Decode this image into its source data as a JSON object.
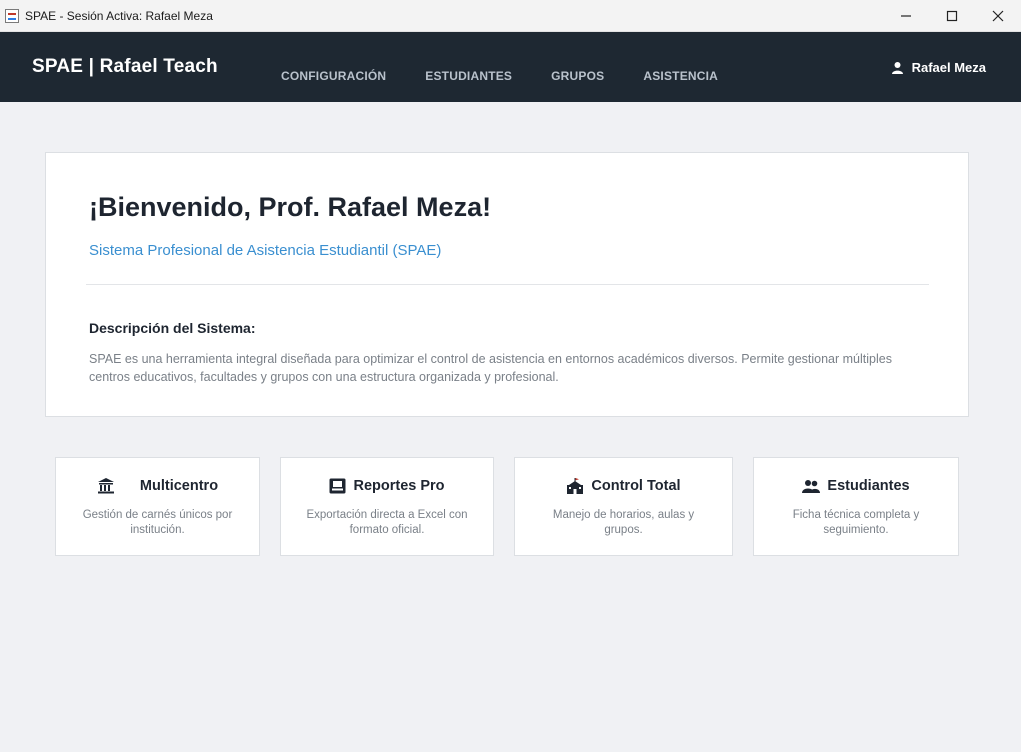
{
  "window": {
    "title": "SPAE - Sesión Activa: Rafael Meza",
    "minimize_icon": "minimize-icon",
    "maximize_icon": "maximize-icon",
    "close_icon": "close-icon"
  },
  "navbar": {
    "brand": "SPAE | Rafael Teach",
    "links": [
      "CONFIGURACIÓN",
      "ESTUDIANTES",
      "GRUPOS",
      "ASISTENCIA"
    ],
    "user": {
      "icon": "user-icon",
      "name": "Rafael Meza"
    }
  },
  "welcome": {
    "title": "¡Bienvenido, Prof. Rafael Meza!",
    "subtitle": "Sistema Profesional de Asistencia Estudiantil (SPAE)",
    "description_title": "Descripción del Sistema:",
    "description": "SPAE es una herramienta integral diseñada para optimizar el control de asistencia en entornos académicos diversos. Permite gestionar múltiples centros educativos, facultades y grupos con una estructura organizada y profesional."
  },
  "features": [
    {
      "icon": "bank-icon",
      "title": "Multicentro",
      "text": "Gestión de carnés únicos por institución."
    },
    {
      "icon": "report-icon",
      "title": "Reportes Pro",
      "text": "Exportación directa a Excel con formato oficial."
    },
    {
      "icon": "school-icon",
      "title": "Control Total",
      "text": "Manejo de horarios, aulas y grupos."
    },
    {
      "icon": "students-icon",
      "title": "Estudiantes",
      "text": "Ficha técnica completa y seguimiento."
    }
  ],
  "colors": {
    "navbar_bg": "#1e2832",
    "accent": "#3a8fd0",
    "page_bg": "#f0f1f4"
  }
}
